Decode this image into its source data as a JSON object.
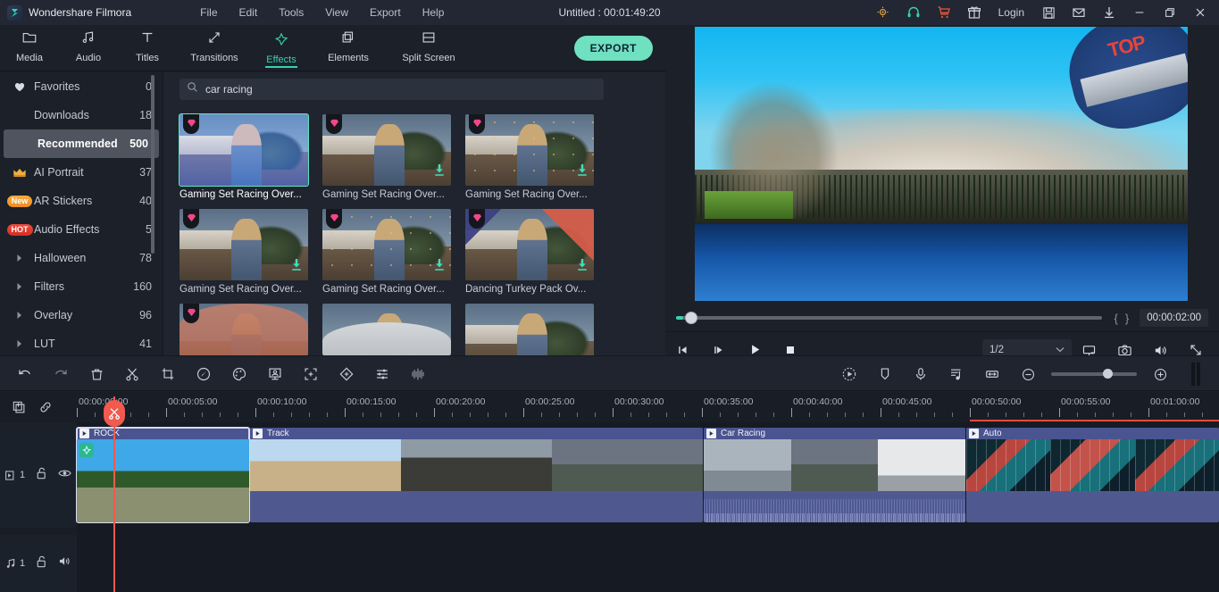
{
  "titlebar": {
    "brand": "Wondershare Filmora",
    "menus": [
      "File",
      "Edit",
      "Tools",
      "View",
      "Export",
      "Help"
    ],
    "document_title": "Untitled : 00:01:49:20",
    "login_label": "Login",
    "icons": [
      "bulb-icon",
      "headset-icon",
      "cart-icon",
      "gift-icon",
      "save-icon",
      "mail-icon",
      "download-icon",
      "minimize-icon",
      "restore-icon",
      "close-icon"
    ]
  },
  "toolbar": {
    "tabs": [
      {
        "label": "Media",
        "icon": "media-folder-icon",
        "active": false
      },
      {
        "label": "Audio",
        "icon": "music-note-icon",
        "active": false
      },
      {
        "label": "Titles",
        "icon": "text-t-icon",
        "active": false
      },
      {
        "label": "Transitions",
        "icon": "transitions-arrow-icon",
        "active": false
      },
      {
        "label": "Effects",
        "icon": "effects-star-icon",
        "active": true
      },
      {
        "label": "Elements",
        "icon": "elements-stack-icon",
        "active": false
      },
      {
        "label": "Split Screen",
        "icon": "split-screen-icon",
        "active": false
      }
    ],
    "export_label": "EXPORT",
    "export_color": "#6fe0c0"
  },
  "sidebar": {
    "items": [
      {
        "label": "Favorites",
        "count": "0",
        "icon": "heart-icon",
        "badge": "",
        "selected": false
      },
      {
        "label": "Downloads",
        "count": "18",
        "icon": "",
        "badge": "",
        "selected": false
      },
      {
        "label": "Recommended",
        "count": "500",
        "icon": "",
        "badge": "",
        "selected": true
      },
      {
        "label": "AI Portrait",
        "count": "37",
        "icon": "crown-icon",
        "badge": "",
        "selected": false
      },
      {
        "label": "AR Stickers",
        "count": "40",
        "icon": "",
        "badge": "New",
        "selected": false
      },
      {
        "label": "Audio Effects",
        "count": "5",
        "icon": "",
        "badge": "HOT",
        "selected": false
      },
      {
        "label": "Halloween",
        "count": "78",
        "icon": "chevron-right-icon",
        "badge": "",
        "selected": false
      },
      {
        "label": "Filters",
        "count": "160",
        "icon": "chevron-right-icon",
        "badge": "",
        "selected": false
      },
      {
        "label": "Overlay",
        "count": "96",
        "icon": "chevron-right-icon",
        "badge": "",
        "selected": false
      },
      {
        "label": "LUT",
        "count": "41",
        "icon": "chevron-right-icon",
        "badge": "",
        "selected": false
      }
    ]
  },
  "search": {
    "value": "car racing",
    "placeholder": "Search",
    "icon": "search-icon"
  },
  "effects": {
    "cards": [
      {
        "name": "Gaming Set Racing Over...",
        "selected": true,
        "downloaded": false,
        "pro": true,
        "art": "blue"
      },
      {
        "name": "Gaming Set Racing Over...",
        "selected": false,
        "downloaded": true,
        "pro": true,
        "art": "plain"
      },
      {
        "name": "Gaming Set Racing Over...",
        "selected": false,
        "downloaded": true,
        "pro": true,
        "art": "sparks"
      },
      {
        "name": "Gaming Set Racing Over...",
        "selected": false,
        "downloaded": true,
        "pro": true,
        "art": "plain"
      },
      {
        "name": "Gaming Set Racing Over...",
        "selected": false,
        "downloaded": true,
        "pro": true,
        "art": "lights"
      },
      {
        "name": "Dancing Turkey Pack Ov...",
        "selected": false,
        "downloaded": true,
        "pro": true,
        "art": "turkey"
      },
      {
        "name": "",
        "selected": false,
        "downloaded": false,
        "pro": true,
        "art": "pink"
      },
      {
        "name": "",
        "selected": false,
        "downloaded": false,
        "pro": false,
        "art": "cloud"
      },
      {
        "name": "",
        "selected": false,
        "downloaded": false,
        "pro": false,
        "art": "plain"
      }
    ]
  },
  "preview": {
    "timecode": "00:00:02:00",
    "mark_in": "{",
    "mark_out": "}",
    "speed": "1/2",
    "controls": [
      "step-back-icon",
      "step-forward-icon",
      "play-icon",
      "stop-icon"
    ],
    "right_icons": [
      "render-preview-icon",
      "snapshot-camera-icon",
      "volume-icon",
      "fullscreen-icon"
    ],
    "helmet_text": "TOP"
  },
  "edit_toolbar": {
    "left_icons": [
      "undo-icon",
      "redo-icon",
      "delete-icon",
      "split-scissors-icon",
      "crop-icon",
      "speed-icon",
      "color-palette-icon",
      "green-screen-icon",
      "auto-reframe-icon",
      "motion-tracking-icon",
      "audio-mixer-icon",
      "audio-detach-icon"
    ],
    "right_icons": [
      "render-preview-icon",
      "marker-icon",
      "voiceover-mic-icon",
      "audio-beat-icon",
      "fit-timeline-icon"
    ],
    "zoom_out": "zoom-out-icon",
    "zoom_in": "zoom-in-icon",
    "zoom_value": 60
  },
  "timeline": {
    "tools": [
      "add-marker-icon",
      "link-icon"
    ],
    "ruler_ticks": [
      "00:00:00:00",
      "00:00:05:00",
      "00:00:10:00",
      "00:00:15:00",
      "00:00:20:00",
      "00:00:25:00",
      "00:00:30:00",
      "00:00:35:00",
      "00:00:40:00",
      "00:00:45:00",
      "00:00:50:00",
      "00:00:55:00",
      "00:01:00:00"
    ],
    "playhead_position": "00:00:02:00",
    "tracks": [
      {
        "name": "video-track-1",
        "index": "1",
        "icon": "video-track-icon",
        "lock": "unlock-icon",
        "eye": "eye-icon"
      },
      {
        "name": "audio-track-1",
        "index": "1",
        "icon": "audio-track-icon",
        "lock": "unlock-icon",
        "eye": "speaker-icon"
      }
    ],
    "clips": [
      {
        "title": "ROCK",
        "selected": true,
        "has_sticker": true,
        "has_audio": false
      },
      {
        "title": "Track",
        "selected": false,
        "has_sticker": false,
        "has_audio": false
      },
      {
        "title": "Car Racing",
        "selected": false,
        "has_sticker": false,
        "has_audio": true
      },
      {
        "title": "Auto",
        "selected": false,
        "has_sticker": false,
        "has_audio": false
      }
    ]
  }
}
